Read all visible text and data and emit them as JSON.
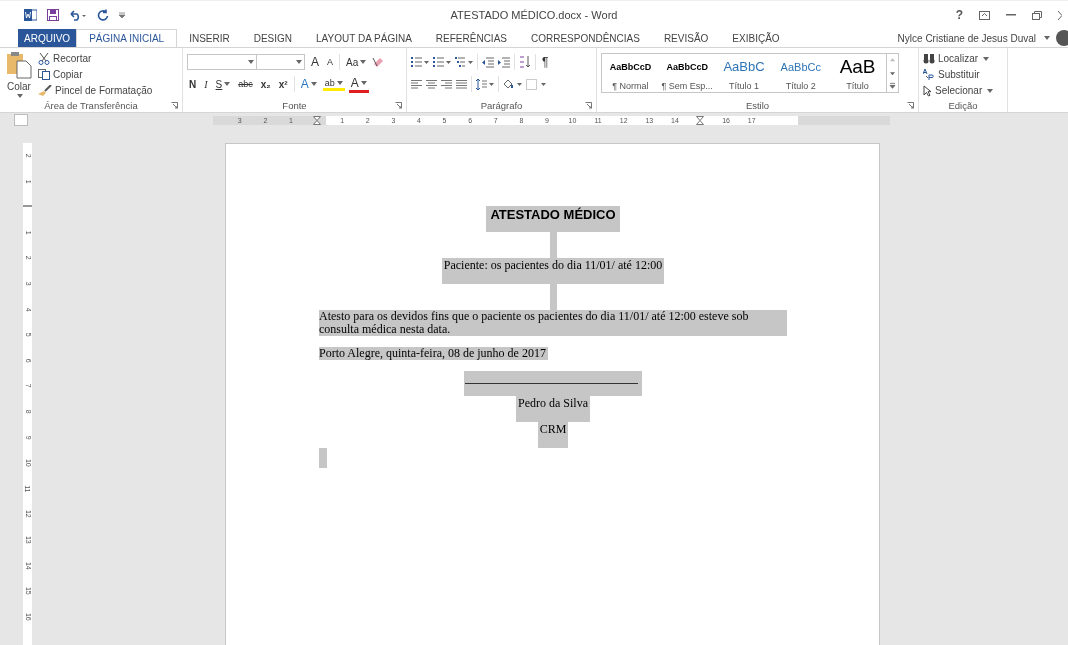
{
  "window": {
    "title": "ATESTADO MÉDICO.docx - Word",
    "help": "?"
  },
  "tabs": [
    {
      "label": "ARQUIVO",
      "kind": "file",
      "selected": false
    },
    {
      "label": "PÁGINA INICIAL",
      "kind": "tab",
      "selected": true
    },
    {
      "label": "INSERIR",
      "kind": "tab",
      "selected": false
    },
    {
      "label": "DESIGN",
      "kind": "tab",
      "selected": false
    },
    {
      "label": "LAYOUT DA PÁGINA",
      "kind": "tab",
      "selected": false
    },
    {
      "label": "REFERÊNCIAS",
      "kind": "tab",
      "selected": false
    },
    {
      "label": "CORRESPONDÊNCIAS",
      "kind": "tab",
      "selected": false
    },
    {
      "label": "REVISÃO",
      "kind": "tab",
      "selected": false
    },
    {
      "label": "EXIBIÇÃO",
      "kind": "tab",
      "selected": false
    }
  ],
  "user": {
    "name": "Nylce Cristiane de Jesus Duval"
  },
  "clipboard": {
    "label": "Área de Transferência",
    "paste": "Colar",
    "cut": "Recortar",
    "copy": "Copiar",
    "painter": "Pincel de Formatação"
  },
  "font": {
    "label": "Fonte",
    "grow": "A",
    "shrink": "A",
    "case": "Aa",
    "bold": "N",
    "italic": "I",
    "underline": "S",
    "strike": "abc",
    "subscript": "x₂",
    "superscript": "x²",
    "effects": "A",
    "highlight": "ab",
    "font_color": "A"
  },
  "paragraph": {
    "label": "Parágrafo",
    "pilcrow": "¶"
  },
  "styles": {
    "label": "Estilo",
    "items": [
      {
        "preview": "AaBbCcD",
        "name": "¶ Normal",
        "kind": "normal"
      },
      {
        "preview": "AaBbCcD",
        "name": "¶ Sem Esp...",
        "kind": "nospace"
      },
      {
        "preview": "AaBbC",
        "name": "Título 1",
        "kind": "h1"
      },
      {
        "preview": "AaBbCc",
        "name": "Título 2",
        "kind": "h2"
      },
      {
        "preview": "AaB",
        "name": "Título",
        "kind": "title"
      }
    ]
  },
  "editing": {
    "label": "Edição",
    "find": "Localizar",
    "replace": "Substituir",
    "select": "Selecionar"
  },
  "ruler": [
    {
      "kind": "number",
      "label": "3"
    },
    {
      "kind": "number",
      "label": "2"
    },
    {
      "kind": "number",
      "label": "1"
    },
    {
      "kind": "marker"
    },
    {
      "kind": "number",
      "label": "1"
    },
    {
      "kind": "number",
      "label": "2"
    },
    {
      "kind": "number",
      "label": "3"
    },
    {
      "kind": "number",
      "label": "4"
    },
    {
      "kind": "number",
      "label": "5"
    },
    {
      "kind": "number",
      "label": "6"
    },
    {
      "kind": "number",
      "label": "7"
    },
    {
      "kind": "number",
      "label": "8"
    },
    {
      "kind": "number",
      "label": "9"
    },
    {
      "kind": "number",
      "label": "10"
    },
    {
      "kind": "number",
      "label": "11"
    },
    {
      "kind": "number",
      "label": "12"
    },
    {
      "kind": "number",
      "label": "13"
    },
    {
      "kind": "number",
      "label": "14"
    },
    {
      "kind": "marker"
    },
    {
      "kind": "number",
      "label": "16"
    },
    {
      "kind": "number",
      "label": "17"
    }
  ],
  "vertical_ruler": [
    {
      "kind": "number",
      "label": "2"
    },
    {
      "kind": "number",
      "label": "1"
    },
    {
      "kind": "marker"
    },
    {
      "kind": "number",
      "label": "1"
    },
    {
      "kind": "number",
      "label": "2"
    },
    {
      "kind": "number",
      "label": "3"
    },
    {
      "kind": "number",
      "label": "4"
    },
    {
      "kind": "number",
      "label": "5"
    },
    {
      "kind": "number",
      "label": "6"
    },
    {
      "kind": "number",
      "label": "7"
    },
    {
      "kind": "number",
      "label": "8"
    },
    {
      "kind": "number",
      "label": "9"
    },
    {
      "kind": "number",
      "label": "10"
    },
    {
      "kind": "number",
      "label": "11"
    },
    {
      "kind": "number",
      "label": "12"
    },
    {
      "kind": "number",
      "label": "13"
    },
    {
      "kind": "number",
      "label": "14"
    },
    {
      "kind": "number",
      "label": "15"
    },
    {
      "kind": "number",
      "label": "16"
    }
  ],
  "document": [
    {
      "kind": "heading",
      "text": "ATESTADO MÉDICO",
      "selected": true
    },
    {
      "kind": "spacer",
      "selected": true
    },
    {
      "kind": "centered",
      "text": "Paciente:  os pacientes do dia 11/01/ até 12:00",
      "selected": true
    },
    {
      "kind": "spacer",
      "selected": true
    },
    {
      "kind": "body",
      "text": "Atesto para os devidos fins que o paciente os pacientes do dia 11/01/ até 12:00 esteve sob consulta médica nesta data.",
      "selected": true
    },
    {
      "kind": "body",
      "text": "Porto Alegre, quinta-feira, 08 de junho de 2017",
      "selected": true
    },
    {
      "kind": "rule",
      "selected": true
    },
    {
      "kind": "centered",
      "text": "Pedro da Silva",
      "selected": true
    },
    {
      "kind": "centered",
      "text": "CRM",
      "selected": true
    },
    {
      "kind": "cursor",
      "selected": true
    }
  ]
}
